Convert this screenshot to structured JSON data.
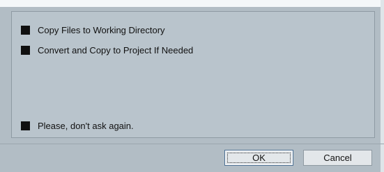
{
  "options": [
    {
      "label": "Copy Files to Working Directory",
      "checked": true
    },
    {
      "label": "Convert and Copy to Project If Needed",
      "checked": true
    }
  ],
  "dont_ask": {
    "label": "Please, don't ask again.",
    "checked": true
  },
  "buttons": {
    "ok_label": "OK",
    "cancel_label": "Cancel"
  },
  "colors": {
    "dialog_background": "#b2bdc5",
    "checkbox_fill": "#101010",
    "button_background": "#e3e7ea",
    "default_button_border": "#4b6f93"
  }
}
